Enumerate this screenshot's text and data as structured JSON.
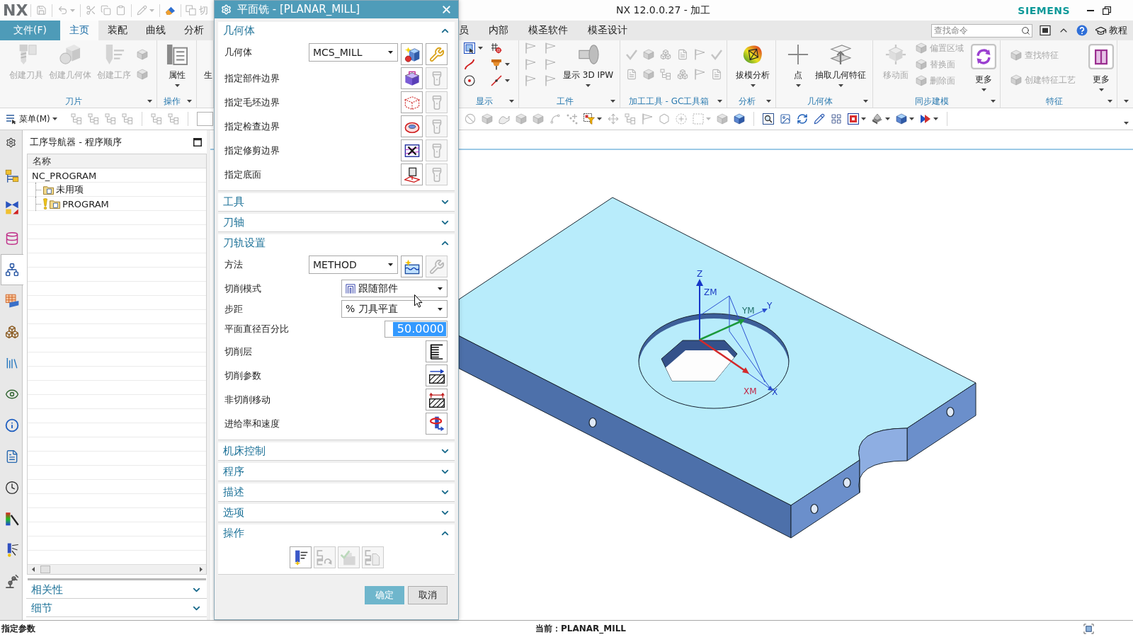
{
  "title_bar": {
    "logo": "NX",
    "quick_access": [
      {
        "disabled": true,
        "dropdown": false
      },
      {
        "disabled": true,
        "dropdown": true
      },
      {
        "disabled": true,
        "dropdown": false
      },
      {
        "disabled": true,
        "dropdown": false
      },
      {
        "disabled": true,
        "dropdown": false
      },
      {
        "disabled": true,
        "dropdown": true
      },
      {
        "disabled": false,
        "dropdown": false
      },
      {
        "disabled": true,
        "dropdown": false,
        "label": "切"
      }
    ],
    "title": "NX 12.0.0.27 - 加工",
    "brand": "SIEMENS"
  },
  "tabs": {
    "left": [
      {
        "label": "文件(F)",
        "kind": "file",
        "selected": false
      },
      {
        "label": "主页",
        "kind": "tab",
        "selected": true
      },
      {
        "label": "装配",
        "kind": "tab",
        "selected": false
      },
      {
        "label": "曲线",
        "kind": "tab",
        "selected": false
      },
      {
        "label": "分析",
        "kind": "tab",
        "selected": false
      }
    ],
    "right": [
      {
        "label": "员",
        "kind": "tab",
        "selected": false
      },
      {
        "label": "内部",
        "kind": "tab",
        "selected": false
      },
      {
        "label": "模圣软件",
        "kind": "tab",
        "selected": false
      },
      {
        "label": "模圣设计",
        "kind": "tab",
        "selected": false
      }
    ]
  },
  "command_search": {
    "placeholder": "查找命令"
  },
  "tutorial": {
    "label": "教程"
  },
  "ribbon": {
    "left": [
      {
        "label": "刀片",
        "items": [
          {
            "kind": "large",
            "label": "创建刀具",
            "disabled": true,
            "dropdown": false
          },
          {
            "kind": "large",
            "label": "创建几何体",
            "disabled": true,
            "dropdown": false
          },
          {
            "kind": "large",
            "label": "创建工序",
            "disabled": true,
            "dropdown": false
          },
          {
            "kind": "icons",
            "icons": [
              {
                "disabled": true,
                "dropdown": false
              },
              {
                "disabled": true,
                "dropdown": false
              }
            ]
          }
        ]
      },
      {
        "label": "操作",
        "items": [
          {
            "kind": "large",
            "label": "属性",
            "disabled": false,
            "dropdown": true
          }
        ]
      },
      {
        "items": [
          {
            "kind": "large",
            "label": "生",
            "disabled": false,
            "dropdown": false
          }
        ]
      }
    ],
    "right": [
      {
        "label": "显示",
        "items": [
          {
            "kind": "icons",
            "icons": [
              {
                "disabled": false,
                "dropdown": true
              },
              {
                "disabled": false,
                "dropdown": false
              },
              {
                "disabled": false,
                "dropdown": false
              },
              {
                "disabled": false,
                "dropdown": true
              },
              {
                "disabled": false,
                "dropdown": false
              },
              {
                "disabled": false,
                "dropdown": true
              }
            ]
          }
        ]
      },
      {
        "label": "工件",
        "items": [
          {
            "kind": "icons",
            "icons": [
              {
                "disabled": true,
                "dropdown": false
              },
              {
                "disabled": true,
                "dropdown": false
              },
              {
                "disabled": true,
                "dropdown": false
              },
              {
                "disabled": true,
                "dropdown": false
              },
              {
                "disabled": true,
                "dropdown": false
              },
              {
                "disabled": true,
                "dropdown": false
              }
            ]
          },
          {
            "kind": "large",
            "label": "显示 3D IPW",
            "disabled": false,
            "dropdown": true
          }
        ]
      },
      {
        "label": "加工工具 - GC工具箱",
        "items": [
          {
            "kind": "icons",
            "icons": [
              {
                "disabled": true,
                "dropdown": false
              },
              {
                "disabled": true,
                "dropdown": false
              },
              {
                "disabled": true,
                "dropdown": false
              },
              {
                "disabled": true,
                "dropdown": false
              },
              {
                "disabled": true,
                "dropdown": false
              },
              {
                "disabled": true,
                "dropdown": false
              },
              {
                "disabled": true,
                "dropdown": false
              },
              {
                "disabled": true,
                "dropdown": false
              },
              {
                "disabled": true,
                "dropdown": false
              },
              {
                "disabled": true,
                "dropdown": false
              },
              {
                "disabled": true,
                "dropdown": false
              },
              {
                "disabled": true,
                "dropdown": false
              }
            ]
          }
        ]
      },
      {
        "label": "分析",
        "items": [
          {
            "kind": "large",
            "label": "拔模分析",
            "disabled": false,
            "dropdown": true
          }
        ]
      },
      {
        "label": "几何体",
        "items": [
          {
            "kind": "large",
            "label": "点",
            "disabled": false,
            "dropdown": true
          },
          {
            "kind": "large",
            "label": "抽取几何特征",
            "disabled": false,
            "dropdown": true
          }
        ]
      },
      {
        "label": "同步建模",
        "items": [
          {
            "kind": "large",
            "label": "移动面",
            "disabled": true,
            "dropdown": false
          },
          {
            "kind": "list",
            "entries": [
              {
                "label": "偏置区域",
                "disabled": true
              },
              {
                "label": "替换面",
                "disabled": true
              },
              {
                "label": "删除面",
                "disabled": true
              }
            ]
          },
          {
            "kind": "more",
            "label": "更多",
            "disabled": false,
            "dropdown": true
          }
        ]
      },
      {
        "label": "特征",
        "items": [
          {
            "kind": "list",
            "entries": [
              {
                "label": "查找特征",
                "disabled": true
              },
              {
                "label": "创建特征工艺",
                "disabled": true
              }
            ]
          },
          {
            "kind": "more",
            "label": "更多",
            "disabled": false,
            "dropdown": true
          }
        ]
      }
    ]
  },
  "toolbar": {
    "menu": "菜单(M)",
    "left_icons": [
      {
        "disabled": true
      },
      {
        "disabled": true
      },
      {
        "disabled": true
      },
      {
        "disabled": true
      },
      {
        "disabled": true
      },
      {
        "disabled": true
      }
    ],
    "right_icons": [
      {
        "disabled": true,
        "dropdown": false
      },
      {
        "disabled": true,
        "dropdown": false
      },
      {
        "disabled": true,
        "dropdown": false
      },
      {
        "disabled": true,
        "dropdown": false
      },
      {
        "disabled": true,
        "dropdown": false
      },
      {
        "disabled": true,
        "dropdown": false
      },
      {
        "disabled": true,
        "dropdown": false
      },
      {
        "disabled": false,
        "dropdown": true
      },
      {
        "disabled": true,
        "dropdown": false
      },
      {
        "disabled": true,
        "dropdown": false
      },
      {
        "disabled": true,
        "dropdown": false
      },
      {
        "disabled": true,
        "dropdown": false
      },
      {
        "disabled": true,
        "dropdown": false
      },
      {
        "disabled": true,
        "dropdown": true
      },
      {
        "disabled": true,
        "dropdown": false
      },
      {
        "disabled": false,
        "dropdown": false
      },
      {
        "disabled": false,
        "dropdown": false
      },
      {
        "disabled": false,
        "dropdown": false
      },
      {
        "disabled": false,
        "dropdown": false
      },
      {
        "disabled": false,
        "dropdown": false
      },
      {
        "disabled": false,
        "dropdown": false
      },
      {
        "disabled": false,
        "dropdown": true
      },
      {
        "disabled": false,
        "dropdown": true
      },
      {
        "disabled": false,
        "dropdown": true
      },
      {
        "disabled": false,
        "dropdown": true
      }
    ]
  },
  "resource_bar": [
    {
      "selected": false
    },
    {
      "selected": false
    },
    {
      "selected": false
    },
    {
      "selected": true
    },
    {
      "selected": false
    },
    {
      "selected": false
    },
    {
      "selected": false
    },
    {
      "selected": false
    },
    {
      "selected": false
    },
    {
      "selected": false
    },
    {
      "selected": false
    },
    {
      "selected": false
    },
    {
      "selected": false
    },
    {
      "selected": false
    }
  ],
  "navigator": {
    "title": "工序导航器 - 程序顺序",
    "column": "名称",
    "tree": [
      {
        "label": "NC_PROGRAM",
        "kind": "root",
        "warning": false,
        "children": [
          {
            "label": "未用项",
            "kind": "group",
            "warning": false
          },
          {
            "label": "PROGRAM",
            "kind": "group",
            "warning": true
          }
        ]
      }
    ],
    "panels": [
      {
        "title": "相关性",
        "expanded": false
      },
      {
        "title": "细节",
        "expanded": false
      }
    ]
  },
  "dialog": {
    "title": "平面铣 - [PLANAR_MILL]",
    "sections": [
      {
        "title": "几何体",
        "expanded": true,
        "rows": [
          {
            "kind": "select",
            "label": "几何体",
            "value": "MCS_MILL",
            "buttons": [
              {
                "disabled": false
              },
              {
                "disabled": false
              }
            ]
          },
          {
            "kind": "specify",
            "label": "指定部件边界",
            "buttons": [
              {
                "disabled": false
              },
              {
                "disabled": true
              }
            ]
          },
          {
            "kind": "specify",
            "label": "指定毛坯边界",
            "buttons": [
              {
                "disabled": false
              },
              {
                "disabled": true
              }
            ]
          },
          {
            "kind": "specify",
            "label": "指定检查边界",
            "buttons": [
              {
                "disabled": false
              },
              {
                "disabled": true
              }
            ]
          },
          {
            "kind": "specify",
            "label": "指定修剪边界",
            "buttons": [
              {
                "disabled": false
              },
              {
                "disabled": true
              }
            ]
          },
          {
            "kind": "specify",
            "label": "指定底面",
            "buttons": [
              {
                "disabled": false
              },
              {
                "disabled": true
              }
            ]
          }
        ]
      },
      {
        "title": "工具",
        "expanded": false
      },
      {
        "title": "刀轴",
        "expanded": false
      },
      {
        "title": "刀轨设置",
        "expanded": true,
        "rows": [
          {
            "kind": "select",
            "label": "方法",
            "value": "METHOD",
            "buttons": [
              {
                "disabled": false
              },
              {
                "disabled": true
              }
            ]
          },
          {
            "kind": "pattern",
            "label": "切削模式",
            "value": "跟随部件"
          },
          {
            "kind": "dropdown",
            "label": "步距",
            "value": "% 刀具平直"
          },
          {
            "kind": "number",
            "label": "平面直径百分比",
            "value": "50.0000",
            "highlighted": true
          },
          {
            "kind": "action",
            "label": "切削层",
            "buttons": [
              {
                "disabled": false
              }
            ]
          },
          {
            "kind": "action",
            "label": "切削参数",
            "buttons": [
              {
                "disabled": false
              }
            ]
          },
          {
            "kind": "action",
            "label": "非切削移动",
            "buttons": [
              {
                "disabled": false
              }
            ]
          },
          {
            "kind": "action",
            "label": "进给率和速度",
            "buttons": [
              {
                "disabled": false
              }
            ]
          }
        ]
      },
      {
        "title": "机床控制",
        "expanded": false
      },
      {
        "title": "程序",
        "expanded": false
      },
      {
        "title": "描述",
        "expanded": false
      },
      {
        "title": "选项",
        "expanded": false
      },
      {
        "title": "操作",
        "expanded": true,
        "actions": [
          {
            "disabled": false
          },
          {
            "disabled": true
          },
          {
            "disabled": true
          },
          {
            "disabled": true
          }
        ]
      }
    ],
    "buttons": [
      {
        "label": "确定",
        "kind": "primary"
      },
      {
        "label": "取消",
        "kind": "secondary"
      }
    ]
  },
  "viewport": {
    "axis_labels": [
      {
        "text": "Z",
        "color": "#1a3ac4"
      },
      {
        "text": "ZM",
        "color": "#1a3ac4"
      },
      {
        "text": "YM",
        "color": "#1f6f6a"
      },
      {
        "text": "Y",
        "color": "#1a3ac4"
      },
      {
        "text": "XM",
        "color": "#c02848"
      },
      {
        "text": "X",
        "color": "#1a3ac4"
      }
    ]
  },
  "status_bar": {
    "prompt": "指定参数",
    "current": "当前：PLANAR_MILL"
  }
}
